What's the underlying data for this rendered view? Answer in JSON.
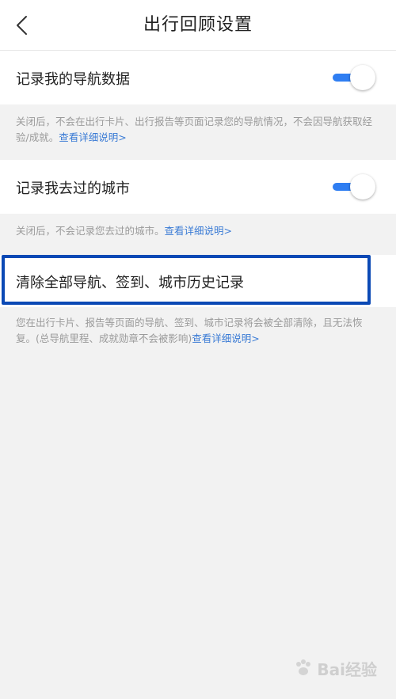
{
  "header": {
    "title": "出行回顾设置"
  },
  "settings": [
    {
      "label": "记录我的导航数据",
      "toggle_on": true,
      "description": "关闭后，不会在出行卡片、出行报告等页面记录您的导航情况，不会因导航获取经验/成就。",
      "link": "查看详细说明>"
    },
    {
      "label": "记录我去过的城市",
      "toggle_on": true,
      "description": "关闭后，不会记录您去过的城市。",
      "link": "查看详细说明>"
    }
  ],
  "clear_action": {
    "label": "清除全部导航、签到、城市历史记录",
    "description": "您在出行卡片、报告等页面的导航、签到、城市记录将会被全部清除，且无法恢复。(总导航里程、成就勋章不会被影响)",
    "link": "查看详细说明>"
  },
  "colors": {
    "accent": "#2f7ef2",
    "link": "#3a7bd5",
    "highlight": "#0b49b5",
    "background": "#f2f2f2"
  },
  "watermark": {
    "text": "Bai经验"
  }
}
